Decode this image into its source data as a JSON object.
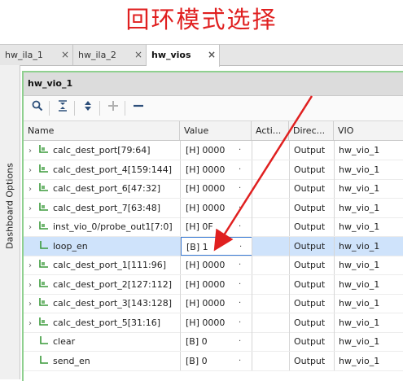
{
  "annotation": {
    "title": "回环模式选择",
    "color": "#e02020"
  },
  "tabs": [
    {
      "label": "hw_ila_1",
      "close": "×",
      "active": false
    },
    {
      "label": "hw_ila_2",
      "close": "×",
      "active": false
    },
    {
      "label": "hw_vios",
      "close": "×",
      "active": true
    }
  ],
  "sidebar": {
    "label": "Dashboard Options"
  },
  "panel": {
    "title": "hw_vio_1"
  },
  "toolbar": {
    "search_icon": "search-icon",
    "collapse_icon": "collapse-all-icon",
    "expand_icon": "expand-all-icon",
    "add_icon": "add-icon",
    "remove_icon": "remove-icon"
  },
  "columns": {
    "name": "Name",
    "value": "Value",
    "activity": "Acti...",
    "direction": "Direc...",
    "vio": "VIO"
  },
  "rows": [
    {
      "name": "calc_dest_port[79:64]",
      "value": "[H] 0000",
      "dd": "·",
      "direction": "Output",
      "vio": "hw_vio_1",
      "expandable": true,
      "bus": true
    },
    {
      "name": "calc_dest_port_4[159:144]",
      "value": "[H] 0000",
      "dd": "·",
      "direction": "Output",
      "vio": "hw_vio_1",
      "expandable": true,
      "bus": true
    },
    {
      "name": "calc_dest_port_6[47:32]",
      "value": "[H] 0000",
      "dd": "·",
      "direction": "Output",
      "vio": "hw_vio_1",
      "expandable": true,
      "bus": true
    },
    {
      "name": "calc_dest_port_7[63:48]",
      "value": "[H] 0000",
      "dd": "·",
      "direction": "Output",
      "vio": "hw_vio_1",
      "expandable": true,
      "bus": true
    },
    {
      "name": "inst_vio_0/probe_out1[7:0]",
      "value": "[H] 0F",
      "dd": "·",
      "direction": "Output",
      "vio": "hw_vio_1",
      "expandable": true,
      "bus": true
    },
    {
      "name": "loop_en",
      "value": "[B] 1",
      "dd": "·",
      "direction": "Output",
      "vio": "hw_vio_1",
      "expandable": false,
      "bus": false,
      "selected": true
    },
    {
      "name": "calc_dest_port_1[111:96]",
      "value": "[H] 0000",
      "dd": "·",
      "direction": "Output",
      "vio": "hw_vio_1",
      "expandable": true,
      "bus": true
    },
    {
      "name": "calc_dest_port_2[127:112]",
      "value": "[H] 0000",
      "dd": "·",
      "direction": "Output",
      "vio": "hw_vio_1",
      "expandable": true,
      "bus": true
    },
    {
      "name": "calc_dest_port_3[143:128]",
      "value": "[H] 0000",
      "dd": "·",
      "direction": "Output",
      "vio": "hw_vio_1",
      "expandable": true,
      "bus": true
    },
    {
      "name": "calc_dest_port_5[31:16]",
      "value": "[H] 0000",
      "dd": "·",
      "direction": "Output",
      "vio": "hw_vio_1",
      "expandable": true,
      "bus": true
    },
    {
      "name": "clear",
      "value": "[B] 0",
      "dd": "·",
      "direction": "Output",
      "vio": "hw_vio_1",
      "expandable": false,
      "bus": false
    },
    {
      "name": "send_en",
      "value": "[B] 0",
      "dd": "·",
      "direction": "Output",
      "vio": "hw_vio_1",
      "expandable": false,
      "bus": false
    }
  ],
  "colors": {
    "selected_row": "#cfe3fb",
    "panel_accent": "#8fd08f",
    "signal_icon": "#3a9a3a",
    "arrow": "#e02020"
  }
}
